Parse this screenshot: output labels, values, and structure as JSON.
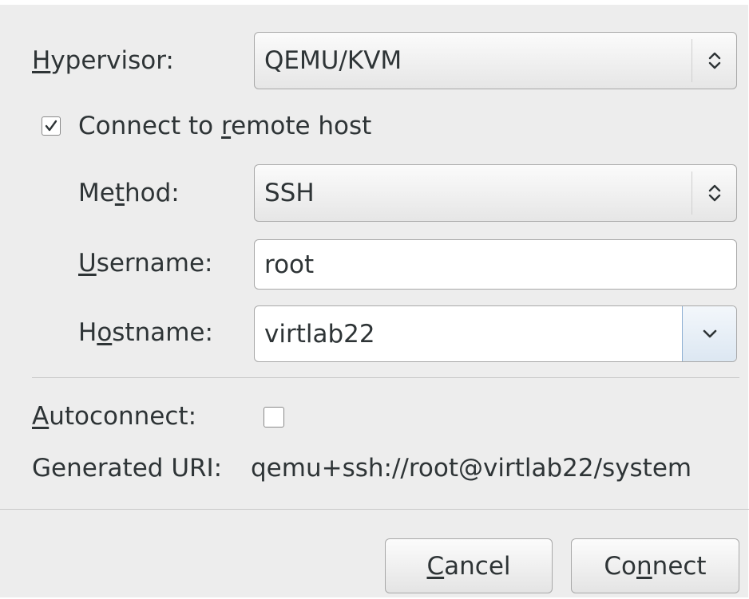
{
  "hypervisor": {
    "label_pre": "",
    "label_mnemonic": "H",
    "label_post": "ypervisor:",
    "value": "QEMU/KVM"
  },
  "remote": {
    "checked": true,
    "label_pre": "Connect to ",
    "label_mnemonic": "r",
    "label_post": "emote host"
  },
  "method": {
    "label_pre": "Me",
    "label_mnemonic": "t",
    "label_post": "hod:",
    "value": "SSH"
  },
  "username": {
    "label_pre": "",
    "label_mnemonic": "U",
    "label_post": "sername:",
    "value": "root"
  },
  "hostname": {
    "label_pre": "H",
    "label_mnemonic": "o",
    "label_post": "stname:",
    "value": "virtlab22"
  },
  "autoconnect": {
    "label_pre": "",
    "label_mnemonic": "A",
    "label_post": "utoconnect:",
    "checked": false
  },
  "uri": {
    "label": "Generated URI:",
    "value": "qemu+ssh://root@virtlab22/system"
  },
  "buttons": {
    "cancel": {
      "pre": "",
      "mnemonic": "C",
      "post": "ancel"
    },
    "connect": {
      "pre": "Co",
      "mnemonic": "n",
      "post": "nect"
    }
  },
  "icons": {
    "combo_arrows": "updown-chevron-icon",
    "dropdown": "chevron-down-icon",
    "check": "checkmark-icon"
  }
}
